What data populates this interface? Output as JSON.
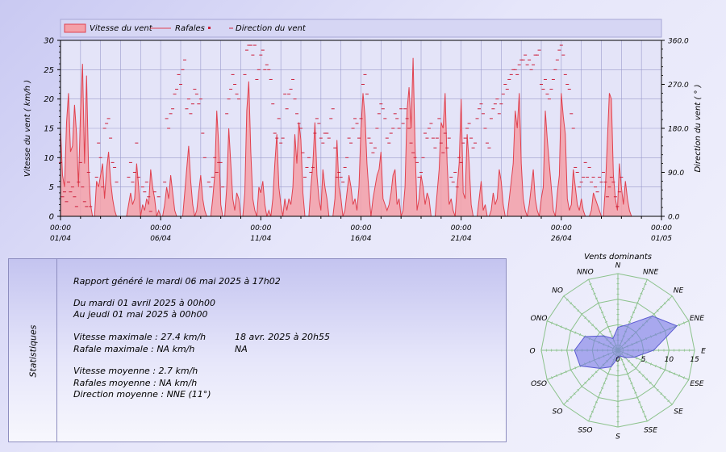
{
  "legend": {
    "speed": "Vitesse du vent",
    "gusts": "Rafales",
    "direction": "Direction du vent"
  },
  "colors": {
    "speed_fill": "#f4a0a8",
    "speed_line": "#e0414f",
    "direction": "#cc1f3a",
    "grid": "#9c9ccc",
    "rose_fill": "#7a7ae6",
    "rose_grid": "#8cc28c"
  },
  "chart_data": [
    {
      "type": "area",
      "ylabel": "Vitesse du vent  ( km/h )",
      "y2label": "Direction du vent  ( ° )",
      "ylim": [
        0,
        30
      ],
      "y2lim": [
        0,
        360
      ],
      "yticks": [
        "0",
        "5",
        "10",
        "15",
        "20",
        "25",
        "30"
      ],
      "y2ticks": [
        "0.0",
        "90.0",
        "180.0",
        "270.0",
        "360.0"
      ],
      "xlim": [
        0,
        30
      ],
      "xticks": [
        {
          "value": 0,
          "time": "00:00",
          "date": "01/04"
        },
        {
          "value": 5,
          "time": "00:00",
          "date": "06/04"
        },
        {
          "value": 10,
          "time": "00:00",
          "date": "11/04"
        },
        {
          "value": 15,
          "time": "00:00",
          "date": "16/04"
        },
        {
          "value": 20,
          "time": "00:00",
          "date": "21/04"
        },
        {
          "value": 25,
          "time": "00:00",
          "date": "26/04"
        },
        {
          "value": 30,
          "time": "00:00",
          "date": "01/05"
        }
      ],
      "grid": true,
      "legend_position": "top",
      "speed_x": [
        0,
        0.1,
        0.2,
        0.3,
        0.4,
        0.5,
        0.6,
        0.7,
        0.8,
        0.9,
        1,
        1.1,
        1.2,
        1.3,
        1.4,
        1.5,
        1.6,
        1.7,
        1.8,
        1.9,
        2,
        2.1,
        2.2,
        2.3,
        2.4,
        2.5,
        2.6,
        2.7,
        2.8,
        2.9,
        3,
        3.1,
        3.2,
        3.3,
        3.4,
        3.5,
        3.6,
        3.7,
        3.8,
        3.9,
        4,
        4.1,
        4.2,
        4.3,
        4.4,
        4.5,
        4.6,
        4.7,
        4.8,
        4.9,
        5,
        5.1,
        5.2,
        5.3,
        5.4,
        5.5,
        5.6,
        5.7,
        5.8,
        5.9,
        6,
        6.1,
        6.2,
        6.3,
        6.4,
        6.5,
        6.6,
        6.7,
        6.8,
        6.9,
        7,
        7.1,
        7.2,
        7.3,
        7.4,
        7.5,
        7.6,
        7.7,
        7.8,
        7.9,
        8,
        8.1,
        8.2,
        8.3,
        8.4,
        8.5,
        8.6,
        8.7,
        8.8,
        8.9,
        9,
        9.1,
        9.2,
        9.3,
        9.4,
        9.5,
        9.6,
        9.7,
        9.8,
        9.9,
        10,
        10.1,
        10.2,
        10.3,
        10.4,
        10.5,
        10.6,
        10.7,
        10.8,
        10.9,
        11,
        11.1,
        11.2,
        11.3,
        11.4,
        11.5,
        11.6,
        11.7,
        11.8,
        11.9,
        12,
        12.1,
        12.2,
        12.3,
        12.4,
        12.5,
        12.6,
        12.7,
        12.8,
        12.9,
        13,
        13.1,
        13.2,
        13.3,
        13.4,
        13.5,
        13.6,
        13.7,
        13.8,
        13.9,
        14,
        14.1,
        14.2,
        14.3,
        14.4,
        14.5,
        14.6,
        14.7,
        14.8,
        14.9,
        15,
        15.1,
        15.2,
        15.3,
        15.4,
        15.5,
        15.6,
        15.7,
        15.8,
        15.9,
        16,
        16.1,
        16.2,
        16.3,
        16.4,
        16.5,
        16.6,
        16.7,
        16.8,
        16.9,
        17,
        17.1,
        17.2,
        17.3,
        17.4,
        17.5,
        17.6,
        17.7,
        17.8,
        17.9,
        18,
        18.1,
        18.2,
        18.3,
        18.4,
        18.5,
        18.6,
        18.7,
        18.8,
        18.9,
        19,
        19.1,
        19.2,
        19.3,
        19.4,
        19.5,
        19.6,
        19.7,
        19.8,
        19.9,
        20,
        20.1,
        20.2,
        20.3,
        20.4,
        20.5,
        20.6,
        20.7,
        20.8,
        20.9,
        21,
        21.1,
        21.2,
        21.3,
        21.4,
        21.5,
        21.6,
        21.7,
        21.8,
        21.9,
        22,
        22.1,
        22.2,
        22.3,
        22.4,
        22.5,
        22.6,
        22.7,
        22.8,
        22.9,
        23,
        23.1,
        23.2,
        23.3,
        23.4,
        23.5,
        23.6,
        23.7,
        23.8,
        23.9,
        24,
        24.1,
        24.2,
        24.3,
        24.4,
        24.5,
        24.6,
        24.7,
        24.8,
        24.9,
        25,
        25.1,
        25.2,
        25.3,
        25.4,
        25.5,
        25.6,
        25.7,
        25.8,
        25.9,
        26,
        26.1,
        26.2,
        26.3,
        26.4,
        26.5,
        26.6,
        26.7,
        26.8,
        26.9,
        27,
        27.1,
        27.2,
        27.3,
        27.4,
        27.5,
        27.6,
        27.7,
        27.8,
        27.9,
        28,
        28.1,
        28.2,
        28.3,
        28.4,
        28.5,
        28.6,
        28.7,
        28.8,
        28.9,
        29,
        29.1,
        29.2,
        29.3,
        29.4,
        29.5,
        29.6,
        29.7,
        29.8,
        29.9,
        30
      ],
      "speed": [
        15,
        7,
        5,
        16,
        21,
        11,
        12,
        19,
        14,
        5,
        18,
        26,
        9,
        24,
        8,
        2,
        0,
        0,
        6,
        5,
        7,
        9,
        3,
        8,
        11,
        6,
        3,
        1,
        0,
        0,
        0,
        0,
        0,
        0,
        2,
        4,
        2,
        3,
        9,
        5,
        0,
        2,
        1,
        3,
        2,
        8,
        5,
        3,
        0,
        1,
        0,
        0,
        2,
        5,
        3,
        7,
        4,
        1,
        0,
        0,
        0,
        0,
        4,
        8,
        12,
        6,
        2,
        0,
        1,
        4,
        7,
        3,
        1,
        0,
        0,
        0,
        3,
        7,
        18,
        12,
        2,
        0,
        0,
        5,
        15,
        9,
        3,
        1,
        4,
        3,
        0,
        0,
        4,
        18,
        23,
        11,
        3,
        1,
        0,
        5,
        4,
        6,
        2,
        0,
        1,
        0,
        3,
        9,
        14,
        5,
        2,
        0,
        3,
        1,
        3,
        2,
        5,
        14,
        9,
        16,
        13,
        4,
        0,
        0,
        0,
        5,
        9,
        16,
        7,
        3,
        1,
        8,
        5,
        3,
        0,
        0,
        0,
        3,
        13,
        5,
        3,
        0,
        1,
        4,
        7,
        5,
        2,
        3,
        1,
        5,
        15,
        21,
        17,
        9,
        4,
        0,
        3,
        5,
        7,
        8,
        11,
        3,
        2,
        1,
        2,
        4,
        7,
        8,
        2,
        3,
        0,
        1,
        5,
        18,
        22,
        15,
        27,
        12,
        1,
        3,
        7,
        5,
        2,
        4,
        3,
        0,
        0,
        0,
        4,
        8,
        16,
        15,
        21,
        9,
        2,
        3,
        1,
        0,
        5,
        9,
        20,
        4,
        3,
        14,
        9,
        2,
        0,
        0,
        0,
        3,
        6,
        1,
        2,
        0,
        0,
        1,
        4,
        2,
        3,
        8,
        6,
        2,
        0,
        0,
        3,
        6,
        9,
        18,
        15,
        21,
        9,
        3,
        1,
        0,
        2,
        5,
        8,
        3,
        1,
        0,
        3,
        5,
        18,
        13,
        9,
        5,
        1,
        0,
        4,
        7,
        21,
        17,
        14,
        3,
        1,
        2,
        8,
        5,
        2,
        1,
        3,
        1,
        0,
        0,
        0,
        1,
        4,
        3,
        2,
        1,
        0,
        0,
        5,
        13,
        21,
        20,
        7,
        3,
        1,
        9,
        5,
        2,
        6,
        3,
        1,
        0,
        0,
        0
      ],
      "direction_deg": [
        110,
        40,
        50,
        30,
        70,
        50,
        60,
        40,
        20,
        70,
        110,
        60,
        30,
        20,
        90,
        20,
        0,
        0,
        80,
        150,
        120,
        60,
        180,
        190,
        200,
        160,
        110,
        100,
        70,
        0,
        0,
        0,
        0,
        0,
        80,
        110,
        70,
        90,
        150,
        80,
        0,
        60,
        50,
        70,
        40,
        10,
        0,
        50,
        0,
        40,
        0,
        0,
        70,
        200,
        180,
        210,
        220,
        250,
        260,
        290,
        270,
        300,
        320,
        220,
        240,
        210,
        230,
        260,
        250,
        230,
        240,
        170,
        120,
        0,
        70,
        60,
        80,
        120,
        90,
        110,
        110,
        60,
        0,
        210,
        240,
        260,
        290,
        270,
        250,
        240,
        0,
        0,
        290,
        340,
        350,
        350,
        330,
        350,
        280,
        300,
        330,
        340,
        300,
        310,
        300,
        280,
        230,
        170,
        160,
        200,
        150,
        160,
        250,
        220,
        250,
        260,
        280,
        240,
        210,
        190,
        180,
        130,
        80,
        100,
        120,
        90,
        100,
        170,
        200,
        190,
        160,
        150,
        170,
        170,
        160,
        200,
        220,
        140,
        80,
        90,
        80,
        70,
        100,
        120,
        160,
        150,
        180,
        200,
        190,
        160,
        200,
        270,
        290,
        250,
        160,
        150,
        130,
        140,
        180,
        210,
        230,
        220,
        200,
        160,
        150,
        170,
        180,
        210,
        200,
        180,
        220,
        190,
        220,
        200,
        180,
        150,
        130,
        120,
        110,
        80,
        90,
        120,
        170,
        160,
        180,
        190,
        160,
        140,
        160,
        200,
        150,
        130,
        170,
        140,
        160,
        80,
        70,
        90,
        60,
        120,
        110,
        150,
        160,
        180,
        190,
        160,
        140,
        150,
        200,
        220,
        230,
        210,
        180,
        150,
        140,
        200,
        220,
        230,
        240,
        210,
        230,
        250,
        270,
        260,
        280,
        290,
        300,
        300,
        290,
        310,
        320,
        320,
        330,
        310,
        320,
        300,
        310,
        330,
        330,
        340,
        270,
        260,
        280,
        250,
        240,
        260,
        280,
        300,
        320,
        340,
        350,
        330,
        290,
        270,
        260,
        210,
        180,
        100,
        90,
        60,
        70,
        80,
        110,
        80,
        100,
        70,
        80,
        60,
        50,
        80,
        70,
        90,
        70,
        40,
        60,
        80,
        70,
        40,
        20,
        50,
        80
      ],
      "gusts": "NA"
    },
    {
      "type": "radar",
      "title": "Vents dominants",
      "categories": [
        "N",
        "NNE",
        "NE",
        "ENE",
        "E",
        "ESE",
        "SE",
        "SSE",
        "S",
        "SSO",
        "SO",
        "OSO",
        "O",
        "ONO",
        "NO",
        "NNO"
      ],
      "values": [
        4.5,
        5.5,
        9.5,
        12.5,
        7,
        3.5,
        2,
        1.2,
        1.5,
        3.5,
        5,
        8,
        8.5,
        7,
        4,
        2.5
      ],
      "rlim": [
        0,
        15
      ],
      "rticks": [
        "0",
        "5",
        "10",
        "15"
      ]
    }
  ],
  "stats": {
    "side_label": "Statistiques",
    "report": "Rapport généré le mardi 06 mai 2025 à 17h02",
    "from": "Du mardi 01 avril 2025 à 00h00",
    "to": "Au jeudi 01 mai 2025 à 00h00",
    "vmax": "Vitesse maximale : 27.4 km/h",
    "vmax_date": "18 avr. 2025 à 20h55",
    "rmax": "Rafale maximale : NA km/h",
    "rmax_date": "NA",
    "vavg": "Vitesse moyenne : 2.7 km/h",
    "ravg": "Rafales moyenne : NA km/h",
    "davg": "Direction moyenne : NNE (11°)"
  }
}
